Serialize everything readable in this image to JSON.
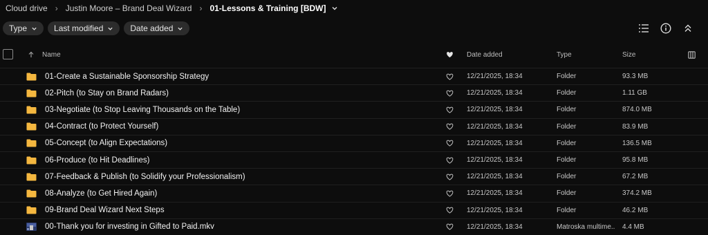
{
  "breadcrumb": {
    "items": [
      "Cloud drive",
      "Justin Moore – Brand Deal Wizard",
      "01-Lessons & Training [BDW]"
    ]
  },
  "filters": [
    "Type",
    "Last modified",
    "Date added"
  ],
  "columns": {
    "name": "Name",
    "date_added": "Date added",
    "type": "Type",
    "size": "Size"
  },
  "files": [
    {
      "name": "01-Create a Sustainable Sponsorship Strategy",
      "date": "12/21/2025, 18:34",
      "type": "Folder",
      "size": "93.3 MB",
      "icon": "folder-icon"
    },
    {
      "name": "02-Pitch (to Stay on Brand Radars)",
      "date": "12/21/2025, 18:34",
      "type": "Folder",
      "size": "1.11 GB",
      "icon": "folder-icon"
    },
    {
      "name": "03-Negotiate (to Stop Leaving Thousands on the Table)",
      "date": "12/21/2025, 18:34",
      "type": "Folder",
      "size": "874.0 MB",
      "icon": "folder-icon"
    },
    {
      "name": "04-Contract (to Protect Yourself)",
      "date": "12/21/2025, 18:34",
      "type": "Folder",
      "size": "83.9 MB",
      "icon": "folder-icon"
    },
    {
      "name": "05-Concept (to Align Expectations)",
      "date": "12/21/2025, 18:34",
      "type": "Folder",
      "size": "136.5 MB",
      "icon": "folder-icon"
    },
    {
      "name": "06-Produce (to Hit Deadlines)",
      "date": "12/21/2025, 18:34",
      "type": "Folder",
      "size": "95.8 MB",
      "icon": "folder-icon"
    },
    {
      "name": "07-Feedback & Publish (to Solidify your Professionalism)",
      "date": "12/21/2025, 18:34",
      "type": "Folder",
      "size": "67.2 MB",
      "icon": "folder-icon"
    },
    {
      "name": "08-Analyze (to Get Hired Again)",
      "date": "12/21/2025, 18:34",
      "type": "Folder",
      "size": "374.2 MB",
      "icon": "folder-icon"
    },
    {
      "name": "09-Brand Deal Wizard Next Steps",
      "date": "12/21/2025, 18:34",
      "type": "Folder",
      "size": "46.2 MB",
      "icon": "folder-icon"
    },
    {
      "name": "00-Thank you for investing in Gifted to Paid.mkv",
      "date": "12/21/2025, 18:34",
      "type": "Matroska multime...",
      "size": "4.4 MB",
      "icon": "video-thumbnail-icon"
    }
  ],
  "colors": {
    "background": "#0d0d0d",
    "folder": "#f4b73f",
    "pill": "#2c2c2c"
  }
}
